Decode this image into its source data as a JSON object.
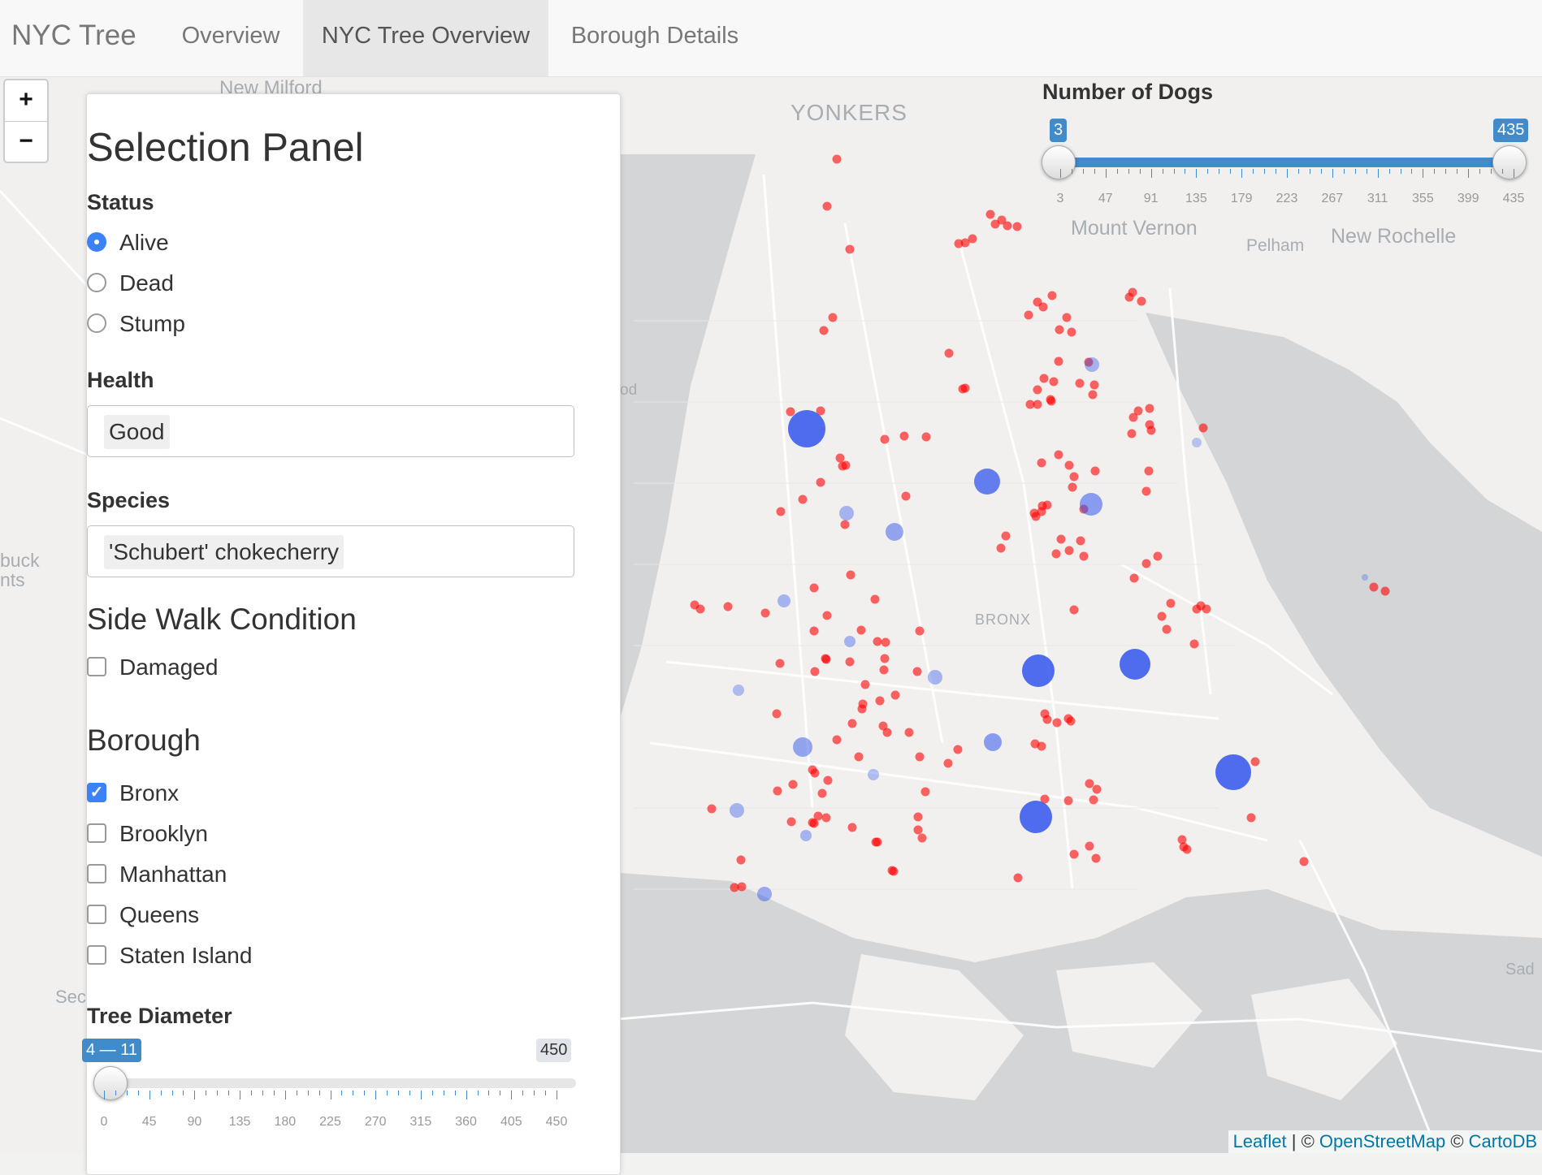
{
  "navbar": {
    "brand": "NYC Tree",
    "tabs": [
      {
        "label": "Overview",
        "active": false
      },
      {
        "label": "NYC Tree Overview",
        "active": true
      },
      {
        "label": "Borough Details",
        "active": false
      }
    ]
  },
  "map": {
    "zoom_in": "+",
    "zoom_out": "−",
    "place_labels": [
      "New Milford",
      "YONKERS",
      "Mount Vernon",
      "Pelham",
      "New Rochelle",
      "BRONX",
      "od",
      "buck",
      "nts",
      "Sec",
      "Sad"
    ],
    "attribution": {
      "leaflet": "Leaflet",
      "sep1": " | © ",
      "osm": "OpenStreetMap",
      "sep2": " © ",
      "carto": "CartoDB"
    },
    "colors": {
      "dead_tree_marker": "#ff0000",
      "blue_marker": "#3355ee",
      "water": "#d4d5d6",
      "land": "#f1f0ee"
    }
  },
  "dogs_slider": {
    "title": "Number of Dogs",
    "min": 3,
    "max": 435,
    "from": "3",
    "to": "435",
    "ticks": [
      "3",
      "47",
      "91",
      "135",
      "179",
      "223",
      "267",
      "311",
      "355",
      "399",
      "435"
    ]
  },
  "panel": {
    "title": "Selection Panel",
    "status": {
      "label": "Status",
      "options": [
        {
          "label": "Alive",
          "checked": true
        },
        {
          "label": "Dead",
          "checked": false
        },
        {
          "label": "Stump",
          "checked": false
        }
      ]
    },
    "health": {
      "label": "Health",
      "value": "Good"
    },
    "species": {
      "label": "Species",
      "value": "'Schubert' chokecherry"
    },
    "sidewalk": {
      "label": "Side Walk Condition",
      "options": [
        {
          "label": "Damaged",
          "checked": false
        }
      ]
    },
    "borough": {
      "label": "Borough",
      "options": [
        {
          "label": "Bronx",
          "checked": true
        },
        {
          "label": "Brooklyn",
          "checked": false
        },
        {
          "label": "Manhattan",
          "checked": false
        },
        {
          "label": "Queens",
          "checked": false
        },
        {
          "label": "Staten Island",
          "checked": false
        }
      ]
    },
    "diameter": {
      "label": "Tree Diameter",
      "range_label": "4 — 11",
      "max_label": "450",
      "min": 0,
      "max": 450,
      "from": 4,
      "to": 11,
      "ticks": [
        "0",
        "45",
        "90",
        "135",
        "180",
        "225",
        "270",
        "315",
        "360",
        "405",
        "450"
      ]
    }
  }
}
